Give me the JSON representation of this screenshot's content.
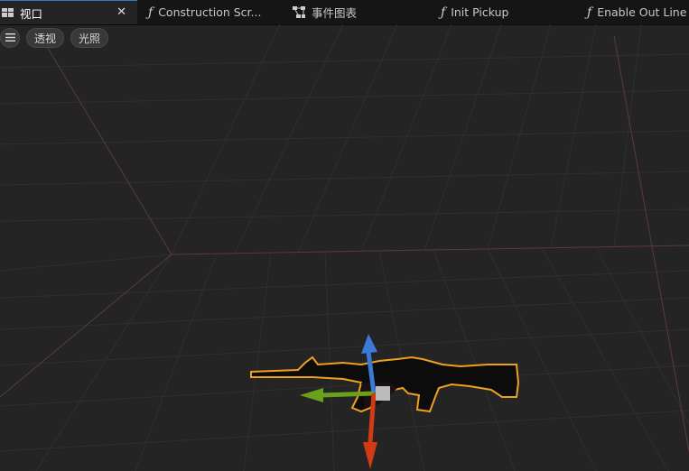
{
  "tabs": [
    {
      "label": "视口",
      "icon": "viewport-grid-icon",
      "active": true,
      "closable": true
    },
    {
      "label": "Construction Scr...",
      "icon": "function-icon"
    },
    {
      "label": "事件图表",
      "icon": "event-graph-icon"
    },
    {
      "label": "Init Pickup",
      "icon": "function-icon"
    },
    {
      "label": "Enable Out Line",
      "icon": "function-icon"
    }
  ],
  "toolbar": {
    "menu_icon": "hamburger-icon",
    "perspective_label": "透视",
    "lighting_label": "光照"
  },
  "viewport": {
    "selected_object": "rifle-mesh",
    "outline_color": "#f0a020",
    "gizmo_colors": {
      "x": "#d03a14",
      "y": "#6aa01a",
      "z": "#3c7ad8"
    }
  },
  "colors": {
    "background": "#242424",
    "tabbar": "#151515",
    "grid_minor": "#2e2e2e",
    "grid_axis": "#5a3a3a",
    "accent": "#3a78c8"
  }
}
